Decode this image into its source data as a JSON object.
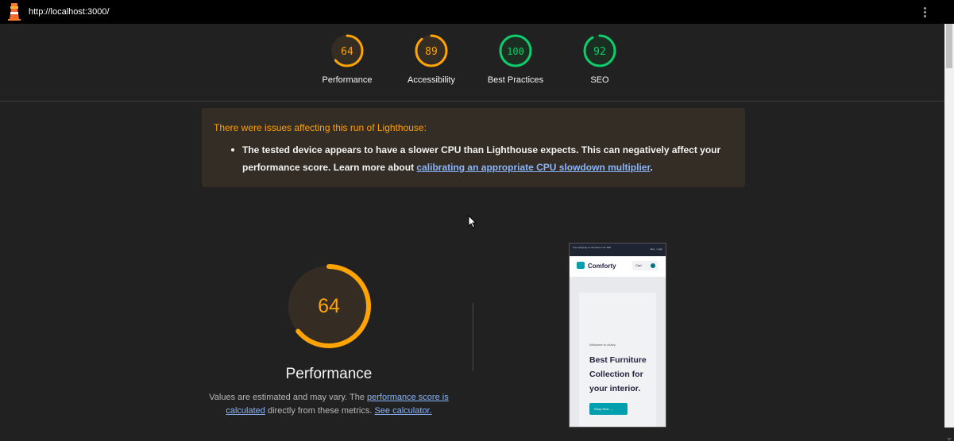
{
  "window": {
    "url": "http://localhost:3000/",
    "icons": {
      "logo": "lighthouse-icon",
      "menu": "kebab-menu-icon"
    }
  },
  "gauges": [
    {
      "label": "Performance",
      "score": "64",
      "value": 64,
      "color": "#ffa400"
    },
    {
      "label": "Accessibility",
      "score": "89",
      "value": 89,
      "color": "#ffa400"
    },
    {
      "label": "Best Practices",
      "score": "100",
      "value": 100,
      "color": "#0cce6b"
    },
    {
      "label": "SEO",
      "score": "92",
      "value": 92,
      "color": "#0cce6b"
    }
  ],
  "warning": {
    "title": "There were issues affecting this run of Lighthouse:",
    "item_text": "The tested device appears to have a slower CPU than Lighthouse expects. This can negatively affect your performance score. Learn more about",
    "item_link": "calibrating an appropriate CPU slowdown multiplier",
    "item_end": "."
  },
  "performance": {
    "score": "64",
    "value": 64,
    "title": "Performance",
    "desc_1": "Values are estimated and may vary. The",
    "link_1": "performance score is calculated",
    "desc_2": "directly from these metrics.",
    "link_2": "See calculator."
  },
  "screenshot": {
    "topbar_text": "Free shipping on all orders over $50",
    "topbar_right": "Eng · Login",
    "brand": "Comforty",
    "cart": "Cart",
    "welcome": "Welcome to chairy",
    "headline": "Best Furniture Collection for your interior.",
    "button": "Shop Now →"
  },
  "colors": {
    "average": "#ffa400",
    "pass": "#0cce6b",
    "link": "#8ab4f8",
    "background": "#212121"
  }
}
